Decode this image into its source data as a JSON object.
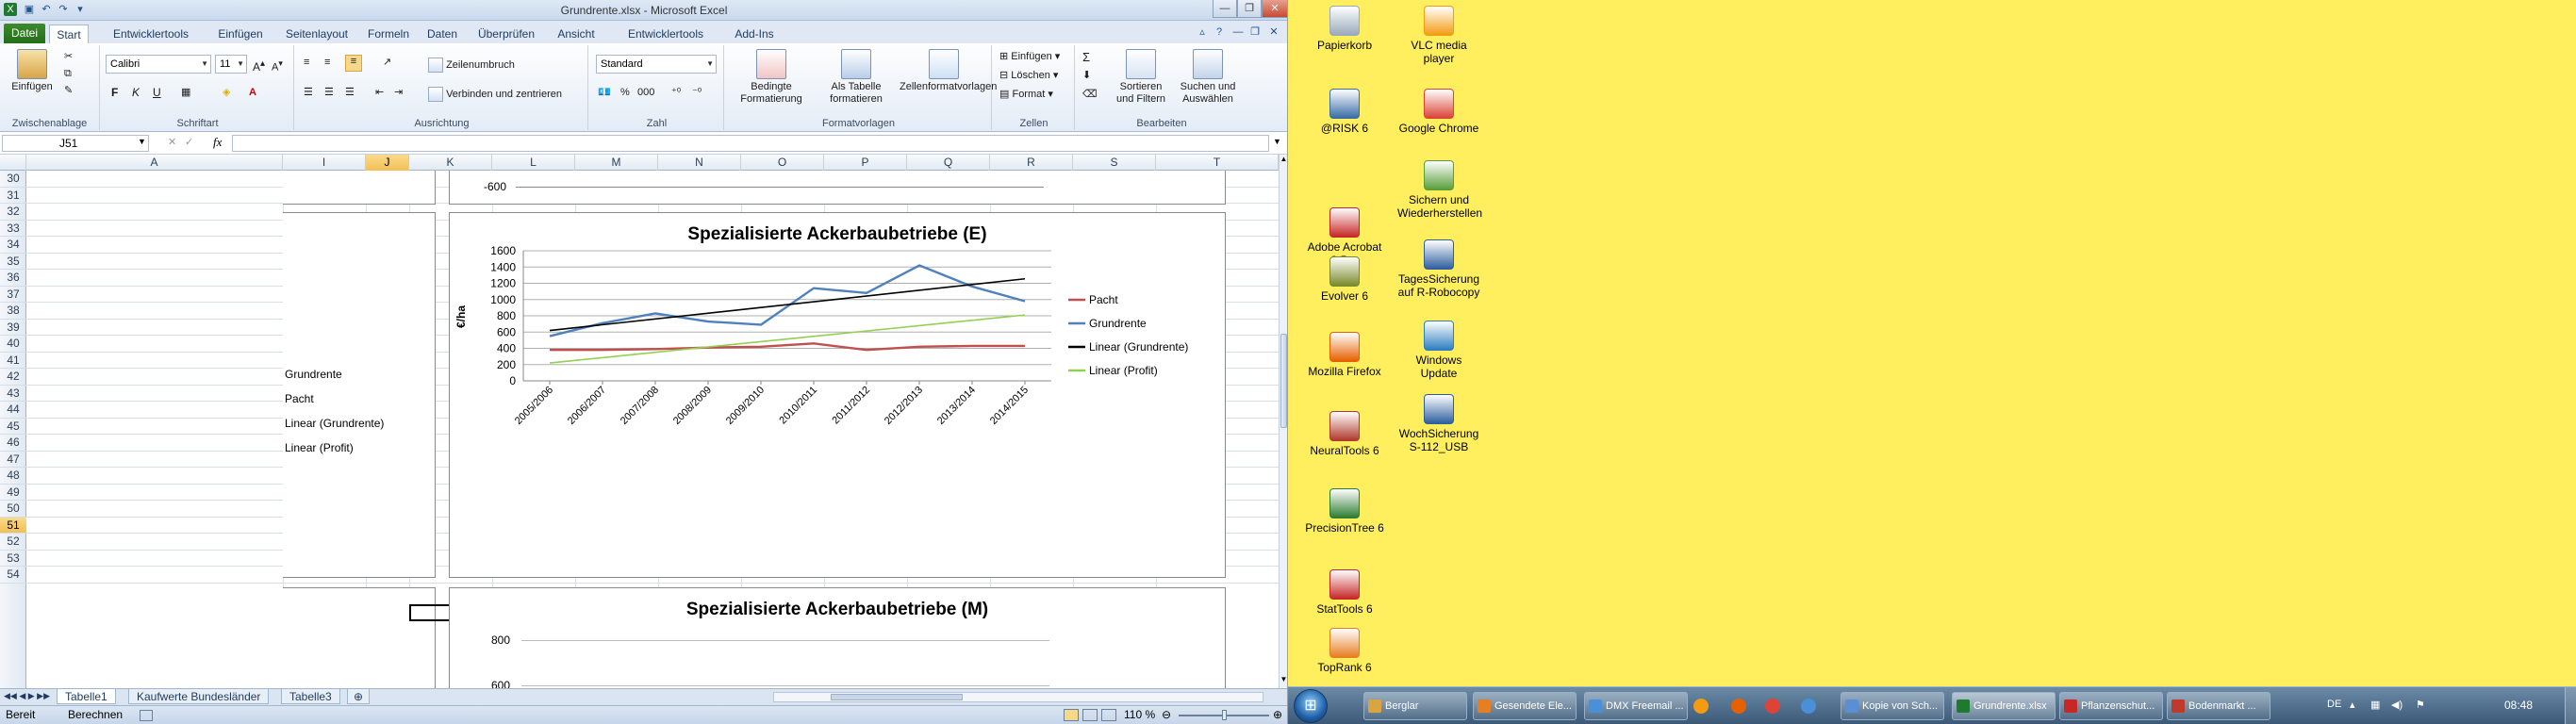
{
  "window": {
    "title": "Grundrente.xlsx - Microsoft Excel"
  },
  "ribbon_tabs": [
    "Datei",
    "Start",
    "Entwicklertools",
    "Einfügen",
    "Seitenlayout",
    "Formeln",
    "Daten",
    "Überprüfen",
    "Ansicht",
    "Entwicklertools",
    "Add-Ins"
  ],
  "ribbon": {
    "clipboard": {
      "paste": "Einfügen",
      "label": "Zwischenablage"
    },
    "font": {
      "name": "Calibri",
      "size": "11",
      "label": "Schriftart",
      "bold": "F",
      "italic": "K",
      "underline": "U"
    },
    "alignment": {
      "wrap": "Zeilenumbruch",
      "merge": "Verbinden und zentrieren",
      "label": "Ausrichtung"
    },
    "number": {
      "format": "Standard",
      "label": "Zahl",
      "percent": "%",
      "thousands": "000"
    },
    "styles": {
      "cond": "Bedingte Formatierung",
      "table": "Als Tabelle formatieren",
      "cell": "Zellenformatvorlagen",
      "label": "Formatvorlagen"
    },
    "cells": {
      "insert": "Einfügen",
      "delete": "Löschen",
      "format": "Format",
      "label": "Zellen"
    },
    "edit": {
      "sort": "Sortieren und Filtern",
      "find": "Suchen und Auswählen",
      "label": "Bearbeiten",
      "sum": "Σ"
    }
  },
  "formula_bar": {
    "name_box": "J51",
    "fx": "fx",
    "value": ""
  },
  "columns": [
    "A",
    "I",
    "J",
    "K",
    "L",
    "M",
    "N",
    "O",
    "P",
    "Q",
    "R",
    "S",
    "T"
  ],
  "selected_column": "J",
  "rows": [
    "30",
    "31",
    "32",
    "33",
    "34",
    "35",
    "36",
    "37",
    "38",
    "39",
    "40",
    "41",
    "42",
    "43",
    "44",
    "45",
    "46",
    "47",
    "48",
    "49",
    "50",
    "51",
    "52",
    "53",
    "54"
  ],
  "selected_row": "51",
  "cells": {
    "I39": "Grundrente",
    "I40": "Pacht",
    "I41": "Linear (Grundrente)",
    "I42": "Linear (Profit)"
  },
  "prev_chart_tick": "-600",
  "chart_data": [
    {
      "type": "line",
      "title": "Spezialisierte  Ackerbaubetriebe  (E)",
      "ylabel": "€/ha",
      "xlabel": "",
      "categories": [
        "2005/2006",
        "2006/2007",
        "2007/2008",
        "2008/2009",
        "2009/2010",
        "2010/2011",
        "2011/2012",
        "2012/2013",
        "2013/2014",
        "2014/2015"
      ],
      "ylim": [
        0,
        1600
      ],
      "yticks": [
        "0",
        "200",
        "400",
        "600",
        "800",
        "1000",
        "1200",
        "1400",
        "1600"
      ],
      "grid": true,
      "legend": "right",
      "series": [
        {
          "name": "Pacht",
          "color": "#c0504d",
          "values": [
            380,
            380,
            390,
            410,
            420,
            460,
            380,
            420,
            430,
            430
          ]
        },
        {
          "name": "Grundrente",
          "color": "#4f81bd",
          "values": [
            550,
            710,
            830,
            730,
            690,
            1140,
            1080,
            1420,
            1160,
            980
          ]
        },
        {
          "name": "Linear (Grundrente)",
          "color": "#000000",
          "values": [
            620,
            690,
            760,
            830,
            900,
            975,
            1045,
            1115,
            1185,
            1255
          ]
        },
        {
          "name": "Linear (Profit)",
          "color": "#92d050",
          "values": [
            220,
            285,
            350,
            415,
            480,
            545,
            610,
            675,
            740,
            810
          ]
        }
      ]
    },
    {
      "type": "line",
      "title": "Spezialisierte  Ackerbaubetriebe  (M)",
      "visible_ticks": [
        "800",
        "600"
      ]
    }
  ],
  "sheet_tabs": [
    "Tabelle1",
    "Kaufwerte Bundesländer",
    "Tabelle3"
  ],
  "active_sheet": "Tabelle1",
  "status": {
    "left": "Bereit",
    "calc": "Berechnen",
    "zoom": "110 %"
  },
  "desktop_icons": [
    {
      "label": "Papierkorb",
      "color": "#9ab"
    },
    {
      "label": "VLC media player",
      "color": "#f39c12"
    },
    {
      "label": "@RISK 6",
      "color": "#3a6ea5"
    },
    {
      "label": "Google Chrome",
      "color": "#db4437"
    },
    {
      "label": "Sichern und Wiederherstellen",
      "color": "#5a9e3a"
    },
    {
      "label": "Adobe Acrobat 9 Pro",
      "color": "#c62828"
    },
    {
      "label": "TagesSicherung auf R-Robocopy",
      "color": "#2f5f9e"
    },
    {
      "label": "Evolver 6",
      "color": "#7a8a2a"
    },
    {
      "label": "Windows Update",
      "color": "#2d7fc1"
    },
    {
      "label": "Mozilla Firefox",
      "color": "#e66000"
    },
    {
      "label": "WochSicherung S-112_USB",
      "color": "#2f5f9e"
    },
    {
      "label": "NeuralTools 6",
      "color": "#b03a2e"
    },
    {
      "label": "PrecisionTree 6",
      "color": "#2e7d32"
    },
    {
      "label": "StatTools 6",
      "color": "#c62828"
    },
    {
      "label": "TopRank 6",
      "color": "#e67e22"
    }
  ],
  "taskbar": {
    "items": [
      "Berglar",
      "Gesendete Ele...",
      "DMX Freemail ...",
      "Kopie von Sch...",
      "Grundrente.xlsx",
      "Pflanzenschut...",
      "Bodenmarkt ..."
    ],
    "lang": "DE",
    "clock": "08:48"
  }
}
